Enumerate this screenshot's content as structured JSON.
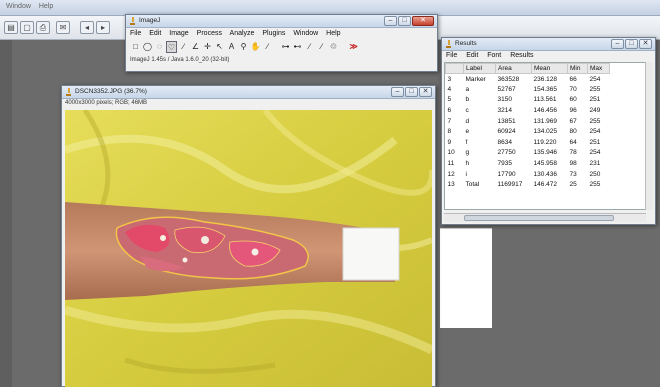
{
  "background_app": {
    "menu": [
      "Window",
      "Help"
    ]
  },
  "imagej": {
    "title": "ImageJ",
    "menu": [
      "File",
      "Edit",
      "Image",
      "Process",
      "Analyze",
      "Plugins",
      "Window",
      "Help"
    ],
    "tools": [
      "□",
      "◯",
      "◌",
      "♡",
      "∕",
      "∠",
      "✛",
      "↖",
      "A",
      "⚲",
      "✋",
      "∕",
      "⊶",
      "⊷",
      "∕",
      "∕",
      "♲",
      "≫"
    ],
    "status": "ImageJ 1.45s / Java 1.6.0_20 (32-bit)"
  },
  "image_window": {
    "title": "DSCN3352.JPG (36.7%)",
    "subtitle": "4000x3000 pixels; RGB; 46MB"
  },
  "results": {
    "title": "Results",
    "menu": [
      "File",
      "Edit",
      "Font",
      "Results"
    ],
    "columns": [
      "",
      "Label",
      "Area",
      "Mean",
      "Min",
      "Max"
    ],
    "rows": [
      [
        "3",
        "Marker",
        "363528",
        "236.128",
        "66",
        "254"
      ],
      [
        "4",
        "a",
        "52767",
        "154.365",
        "70",
        "255"
      ],
      [
        "5",
        "b",
        "3150",
        "113.561",
        "60",
        "251"
      ],
      [
        "6",
        "c",
        "3214",
        "146.456",
        "96",
        "249"
      ],
      [
        "7",
        "d",
        "13851",
        "131.969",
        "67",
        "255"
      ],
      [
        "8",
        "e",
        "60924",
        "134.025",
        "80",
        "254"
      ],
      [
        "9",
        "f",
        "8634",
        "119.220",
        "64",
        "251"
      ],
      [
        "10",
        "g",
        "27750",
        "135.946",
        "78",
        "254"
      ],
      [
        "11",
        "h",
        "7935",
        "145.958",
        "98",
        "231"
      ],
      [
        "12",
        "i",
        "17790",
        "130.436",
        "73",
        "250"
      ],
      [
        "13",
        "Total",
        "1169917",
        "146.472",
        "25",
        "255"
      ]
    ]
  },
  "colors": {
    "bag_yellow": "#dcd345",
    "skin": "#c58a6a",
    "wound": "#d9536b",
    "outline": "#f2c548"
  }
}
